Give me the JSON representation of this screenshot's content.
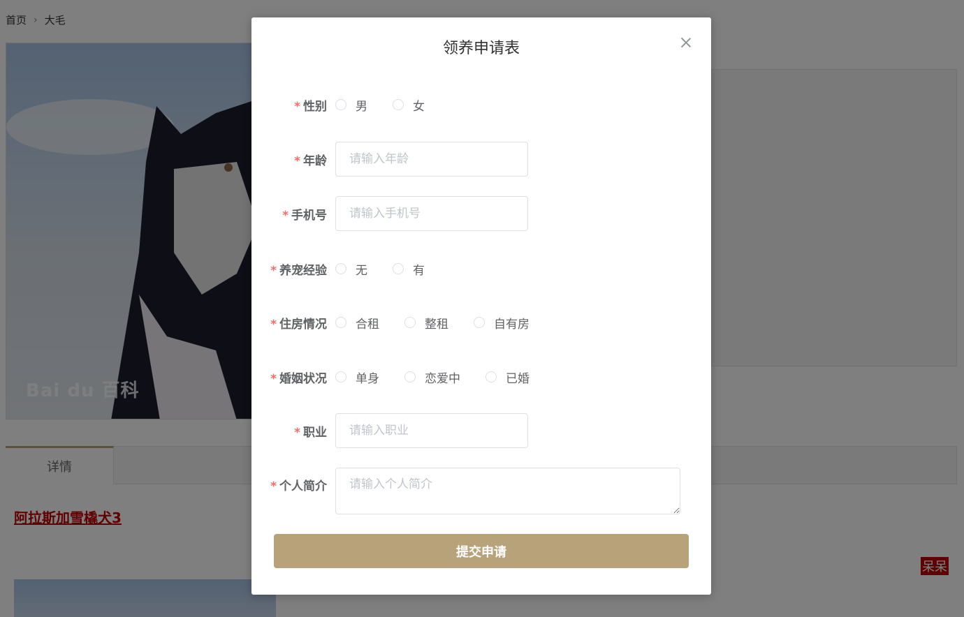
{
  "breadcrumb": {
    "home": "首页",
    "separator": "›",
    "current": "大毛"
  },
  "photo": {
    "watermark": "Bai du 百科"
  },
  "tabs": {
    "detail": "详情"
  },
  "dog": {
    "title": "阿拉斯加雪橇犬3"
  },
  "badge": {
    "text": "呆呆"
  },
  "modal": {
    "title": "领养申请表",
    "required_mark": "*",
    "gender": {
      "label": "性别",
      "options": [
        "男",
        "女"
      ]
    },
    "age": {
      "label": "年龄",
      "placeholder": "请输入年龄"
    },
    "phone": {
      "label": "手机号",
      "placeholder": "请输入手机号"
    },
    "pet_experience": {
      "label": "养宠经验",
      "options": [
        "无",
        "有"
      ]
    },
    "housing": {
      "label": "住房情况",
      "options": [
        "合租",
        "整租",
        "自有房"
      ]
    },
    "marital": {
      "label": "婚姻状况",
      "options": [
        "单身",
        "恋爱中",
        "已婚"
      ]
    },
    "occupation": {
      "label": "职业",
      "placeholder": "请输入职业"
    },
    "intro": {
      "label": "个人简介",
      "placeholder": "请输入个人简介"
    },
    "submit_label": "提交申请"
  },
  "colors": {
    "accent": "#b8a27a",
    "required": "#f56c6c",
    "title_link": "#c00000"
  }
}
